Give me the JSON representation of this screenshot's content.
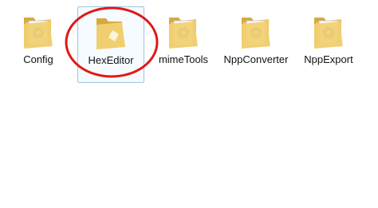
{
  "explorer": {
    "folders": [
      {
        "label": "Config",
        "icon": "folder-with-gear-icon"
      },
      {
        "label": "HexEditor",
        "icon": "folder-icon",
        "selected": true
      },
      {
        "label": "mimeTools",
        "icon": "folder-with-gear-icon"
      },
      {
        "label": "NppConverter",
        "icon": "folder-with-gear-icon"
      },
      {
        "label": "NppExport",
        "icon": "folder-with-gear-icon"
      }
    ]
  },
  "annotation": {
    "type": "circle",
    "color": "#e11818"
  },
  "colors": {
    "folder": "#f1cf70",
    "folder_dark": "#d7a93f",
    "selection_border": "#9fc4e6",
    "selection_fill": "#e5f3ff",
    "annotation": "#e11818"
  }
}
